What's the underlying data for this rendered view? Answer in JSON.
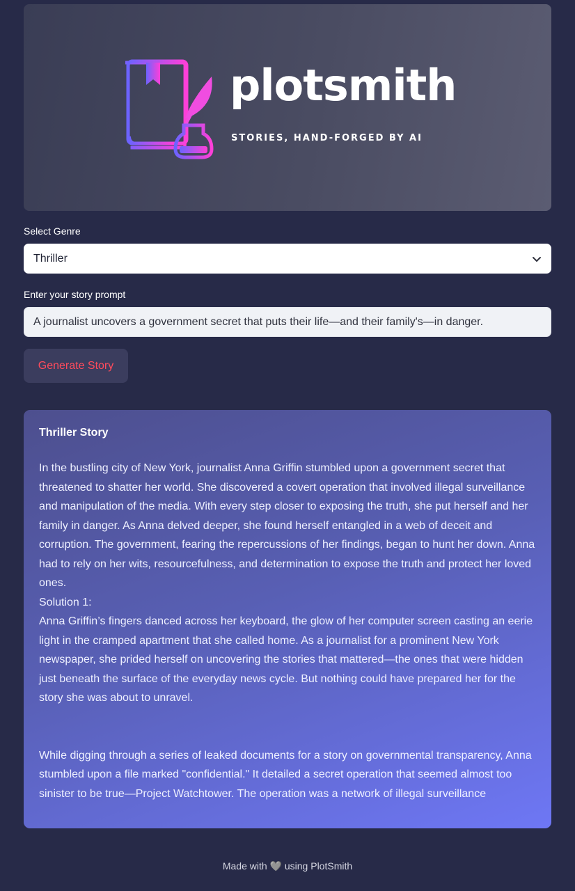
{
  "brand": {
    "name": "plotsmith",
    "tagline": "STORIES, HAND-FORGED BY AI",
    "logo_icon": "book-and-quill-icon",
    "colors": {
      "gradient_start": "#6c63ff",
      "gradient_end": "#ff3fd8"
    }
  },
  "genre": {
    "label": "Select Genre",
    "selected": "Thriller",
    "icon": "chevron-down-icon"
  },
  "prompt": {
    "label": "Enter your story prompt",
    "value": "A journalist uncovers a government secret that puts their life—and their family's—in danger."
  },
  "generate_button": {
    "label": "Generate Story",
    "color": "#ff4b5c"
  },
  "story": {
    "title": "Thriller Story",
    "paragraph_1": "In the bustling city of New York, journalist Anna Griffin stumbled upon a government secret that threatened to shatter her world. She discovered a covert operation that involved illegal surveillance and manipulation of the media. With every step closer to exposing the truth, she put herself and her family in danger. As Anna delved deeper, she found herself entangled in a web of deceit and corruption. The government, fearing the repercussions of her findings, began to hunt her down. Anna had to rely on her wits, resourcefulness, and determination to expose the truth and protect her loved ones.",
    "solution_label": "Solution 1:",
    "paragraph_2": "Anna Griffin’s fingers danced across her keyboard, the glow of her computer screen casting an eerie light in the cramped apartment that she called home. As a journalist for a prominent New York newspaper, she prided herself on uncovering the stories that mattered—the ones that were hidden just beneath the surface of the everyday news cycle. But nothing could have prepared her for the story she was about to unravel.",
    "paragraph_3": "While digging through a series of leaked documents for a story on governmental transparency, Anna stumbled upon a file marked \"confidential.\" It detailed a secret operation that seemed almost too sinister to be true—Project Watchtower. The operation was a network of illegal surveillance"
  },
  "footer": {
    "prefix": "Made with",
    "heart": "🩶",
    "suffix": "using PlotSmith"
  }
}
